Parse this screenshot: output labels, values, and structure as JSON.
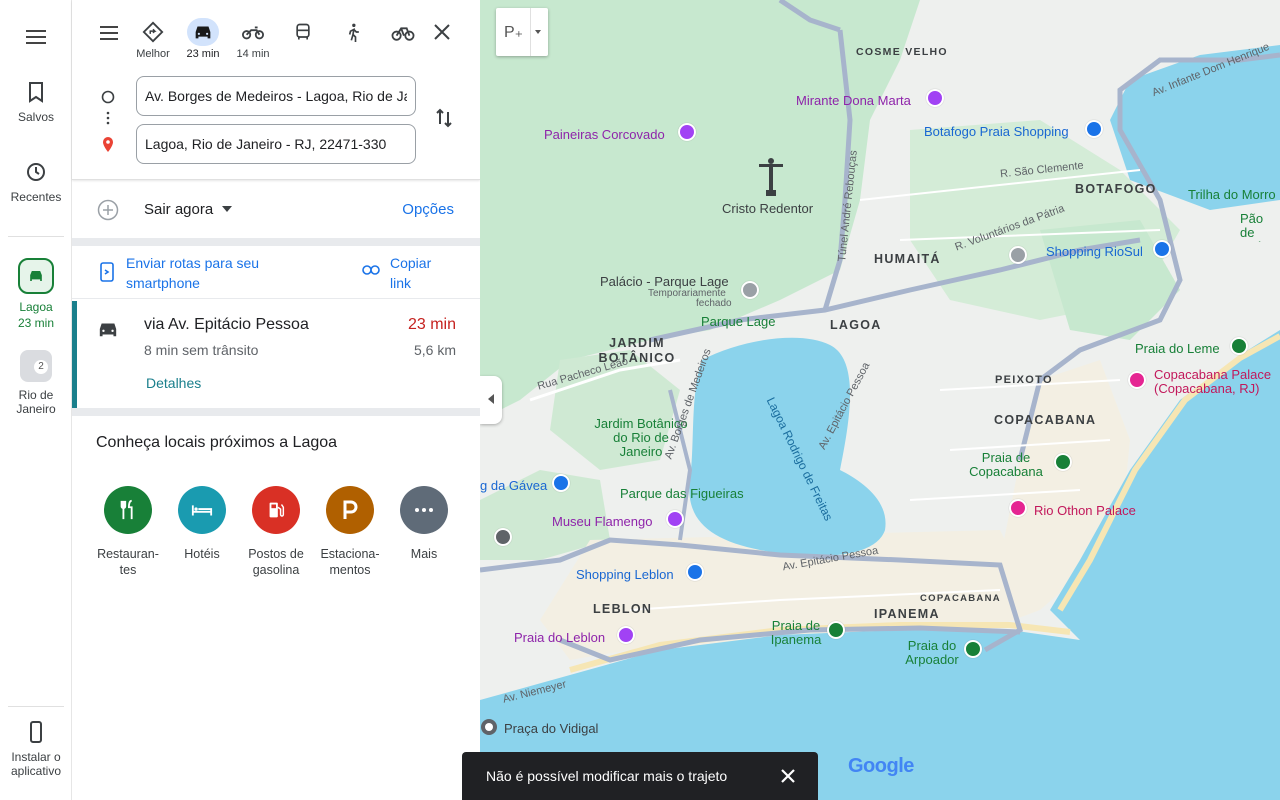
{
  "rail": {
    "saved_label": "Salvos",
    "recent_label": "Recentes",
    "lagoa_label": "Lagoa",
    "lagoa_time": "23 min",
    "rio_label": "Rio de Janeiro",
    "rio_badge": "2",
    "install_label": "Instalar o aplicativo"
  },
  "modes": [
    {
      "name": "best",
      "label": "Melhor"
    },
    {
      "name": "car",
      "label": "23 min"
    },
    {
      "name": "moto",
      "label": "14 min"
    },
    {
      "name": "transit",
      "label": ""
    },
    {
      "name": "walk",
      "label": ""
    },
    {
      "name": "bike",
      "label": ""
    }
  ],
  "origin_value": "Av. Borges de Medeiros - Lagoa, Rio de Janeiro",
  "destination_value": "Lagoa, Rio de Janeiro - RJ, 22471-330",
  "departure": {
    "label": "Sair agora",
    "options": "Opções"
  },
  "send": {
    "label": "Enviar rotas para seu smartphone",
    "copy": "Copiar link"
  },
  "route": {
    "via": "via Av. Epitácio Pessoa",
    "time": "23 min",
    "traffic": "8 min sem trânsito",
    "distance": "5,6 km",
    "details": "Detalhes"
  },
  "explore": {
    "title": "Conheça locais próximos a Lagoa",
    "categories": [
      {
        "label": "Restauran-tes",
        "color": "#188038",
        "icon": "fork-knife-icon"
      },
      {
        "label": "Hotéis",
        "color": "#1a9bb0",
        "icon": "bed-icon"
      },
      {
        "label": "Postos de gasolina",
        "color": "#d93025",
        "icon": "fuel-icon"
      },
      {
        "label": "Estaciona-mentos",
        "color": "#b06000",
        "icon": "parking-icon"
      },
      {
        "label": "Mais",
        "color": "#5f6b78",
        "icon": "more-icon"
      }
    ]
  },
  "map": {
    "hoods": [
      "COSME VELHO",
      "BOTAFOGO",
      "HUMAITÁ",
      "LAGOA",
      "JARDIM BOTÂNICO",
      "PEIXOTO",
      "COPACABANA",
      "LEBLON",
      "IPANEMA"
    ],
    "pois": {
      "mirante": "Mirante Dona Marta",
      "paineiras": "Paineiras Corcovado",
      "cristo": "Cristo Redentor",
      "botafogo_shop": "Botafogo Praia Shopping",
      "riosul": "Shopping RioSul",
      "palacio": "Palácio - Parque Lage",
      "palacio_sub1": "Temporariamente",
      "palacio_sub2": "fechado",
      "parque_lage": "Parque Lage",
      "jardim_bot": "Jardim Botânico do Rio de Janeiro",
      "gavea": "g da Gávea",
      "figueiras": "Parque das Figueiras",
      "flamengo": "Museu Flamengo",
      "leblon_shop": "Shopping Leblon",
      "praia_leblon": "Praia do Leblon",
      "praia_ipanema": "Praia de Ipanema",
      "praia_arpoador": "Praia do Arpoador",
      "praia_leme": "Praia do Leme",
      "copa_palace": "Copacabana Palace (Copacabana, RJ)",
      "praia_copa": "Praia de Copacabana",
      "rio_othon": "Rio Othon Palace",
      "vidigal": "Praça do Vidigal",
      "trilha": "Trilha do Morro",
      "pao": "Pão de Açúcar Vermelh",
      "copacabana_small": "COPACABANA"
    },
    "streets": {
      "infante": "Av. Infante Dom Henrique",
      "sao_clemente": "R. São Clemente",
      "voluntarios": "R. Voluntários da Pátria",
      "tunel": "Túnel André Rebouças",
      "pacheco": "Rua Pacheco Leão",
      "borges": "Av. Borges de Medeiros",
      "epitacio": "Av. Epitácio Pessoa",
      "epitacio2": "Av. Epitácio Pessoa",
      "niemeyer": "Av. Niemeyer"
    },
    "lagoa_water": "Lagoa Rodrigo de Freitas",
    "google": "Google"
  },
  "snackbar": {
    "message": "Não é possível modificar mais o trajeto"
  }
}
